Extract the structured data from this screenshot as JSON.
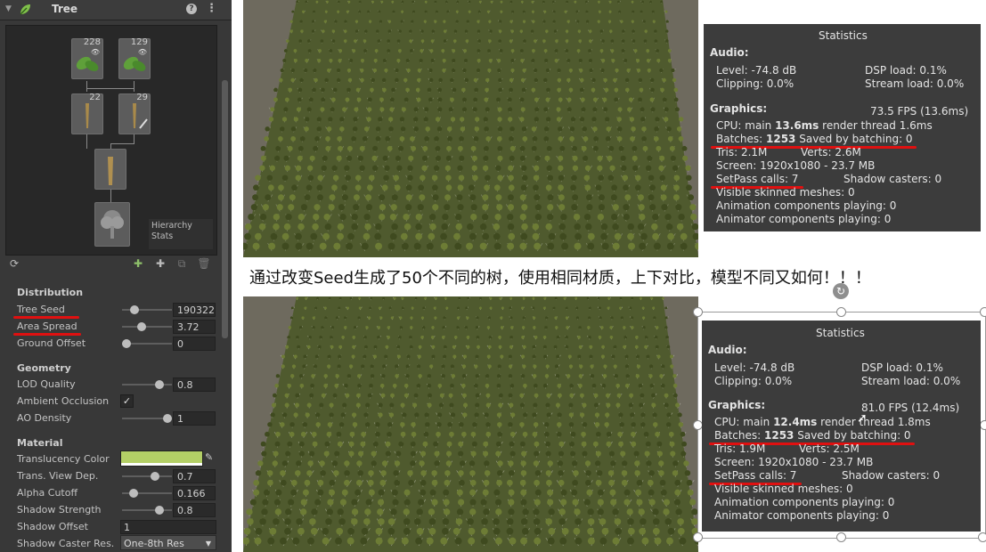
{
  "inspector": {
    "title": "Tree",
    "hierarchy": {
      "nodes": [
        {
          "name": "leaf-group-1",
          "count": "228"
        },
        {
          "name": "leaf-group-2",
          "count": "129"
        },
        {
          "name": "branch-group-1",
          "count": "22"
        },
        {
          "name": "branch-group-2",
          "count": "29"
        },
        {
          "name": "trunk",
          "count": ""
        },
        {
          "name": "root",
          "count": ""
        }
      ],
      "stats_label": "Hierarchy Stats"
    },
    "distribution": {
      "header": "Distribution",
      "tree_seed_label": "Tree Seed",
      "tree_seed_value": "190322",
      "tree_seed_level": 0.2,
      "area_spread_label": "Area Spread",
      "area_spread_value": "3.72",
      "area_spread_level": 0.37,
      "ground_offset_label": "Ground Offset",
      "ground_offset_value": "0",
      "ground_offset_level": 0.0
    },
    "geometry": {
      "header": "Geometry",
      "lod_quality_label": "LOD Quality",
      "lod_quality_value": "0.8",
      "lod_quality_level": 0.8,
      "ambient_occlusion_label": "Ambient Occlusion",
      "ambient_occlusion_checked": true,
      "ambient_occlusion_mark": "✓",
      "ao_density_label": "AO Density",
      "ao_density_value": "1",
      "ao_density_level": 1.0
    },
    "material": {
      "header": "Material",
      "translucency_label": "Translucency Color",
      "translucency_color": "#b3cf66",
      "trans_view_dep_label": "Trans. View Dep.",
      "trans_view_dep_value": "0.7",
      "trans_view_dep_level": 0.7,
      "alpha_cutoff_label": "Alpha Cutoff",
      "alpha_cutoff_value": "0.166",
      "alpha_cutoff_level": 0.166,
      "shadow_strength_label": "Shadow Strength",
      "shadow_strength_value": "0.8",
      "shadow_strength_level": 0.8,
      "shadow_offset_label": "Shadow Offset",
      "shadow_offset_value": "1",
      "shadow_caster_res_label": "Shadow Caster Res.",
      "shadow_caster_res_value": "One-8th Res"
    }
  },
  "caption": "通过改变Seed生成了50个不同的树，使用相同材质，上下对比，模型不同又如何！！！",
  "stats_top": {
    "title": "Statistics",
    "audio": "Audio:",
    "level": "Level: -74.8 dB",
    "dsp": "DSP load: 0.1%",
    "clipping": "Clipping: 0.0%",
    "stream": "Stream load: 0.0%",
    "graphics": "Graphics:",
    "fps": "73.5 FPS (13.6ms)",
    "cpu_pre": "CPU: main ",
    "cpu_main": "13.6ms",
    "cpu_post": "  render thread 1.6ms",
    "batches_pre": "Batches: ",
    "batches": "1253",
    "batches_post": "  Saved by batching: 0",
    "tris": "Tris: 2.1M",
    "verts": "Verts: 2.6M",
    "screen": "Screen: 1920x1080 - 23.7 MB",
    "setpass": "SetPass calls: 7",
    "shadow_casters": "Shadow casters: 0",
    "skinned": "Visible skinned meshes: 0",
    "animation": "Animation components playing: 0",
    "animator": "Animator components playing: 0"
  },
  "stats_bottom": {
    "title": "Statistics",
    "audio": "Audio:",
    "level": "Level: -74.8 dB",
    "dsp": "DSP load: 0.1%",
    "clipping": "Clipping: 0.0%",
    "stream": "Stream load: 0.0%",
    "graphics": "Graphics:",
    "fps": "81.0 FPS (12.4ms)",
    "cpu_pre": "CPU: main ",
    "cpu_main": "12.4ms",
    "cpu_post": "  render thread 1.8ms",
    "batches_pre": "Batches: ",
    "batches": "1253",
    "batches_post": "  Saved by batching: 0",
    "tris": "Tris: 1.9M",
    "verts": "Verts: 2.5M",
    "screen": "Screen: 1920x1080 - 23.7 MB",
    "setpass": "SetPass calls: 7",
    "shadow_casters": "Shadow casters: 0",
    "skinned": "Visible skinned meshes: 0",
    "animation": "Animation components playing: 0",
    "animator": "Animator components playing: 0"
  },
  "colors": {
    "accent_red": "#e01010",
    "stats_bg": "#3c3c3c",
    "inspector_bg": "#383838"
  }
}
